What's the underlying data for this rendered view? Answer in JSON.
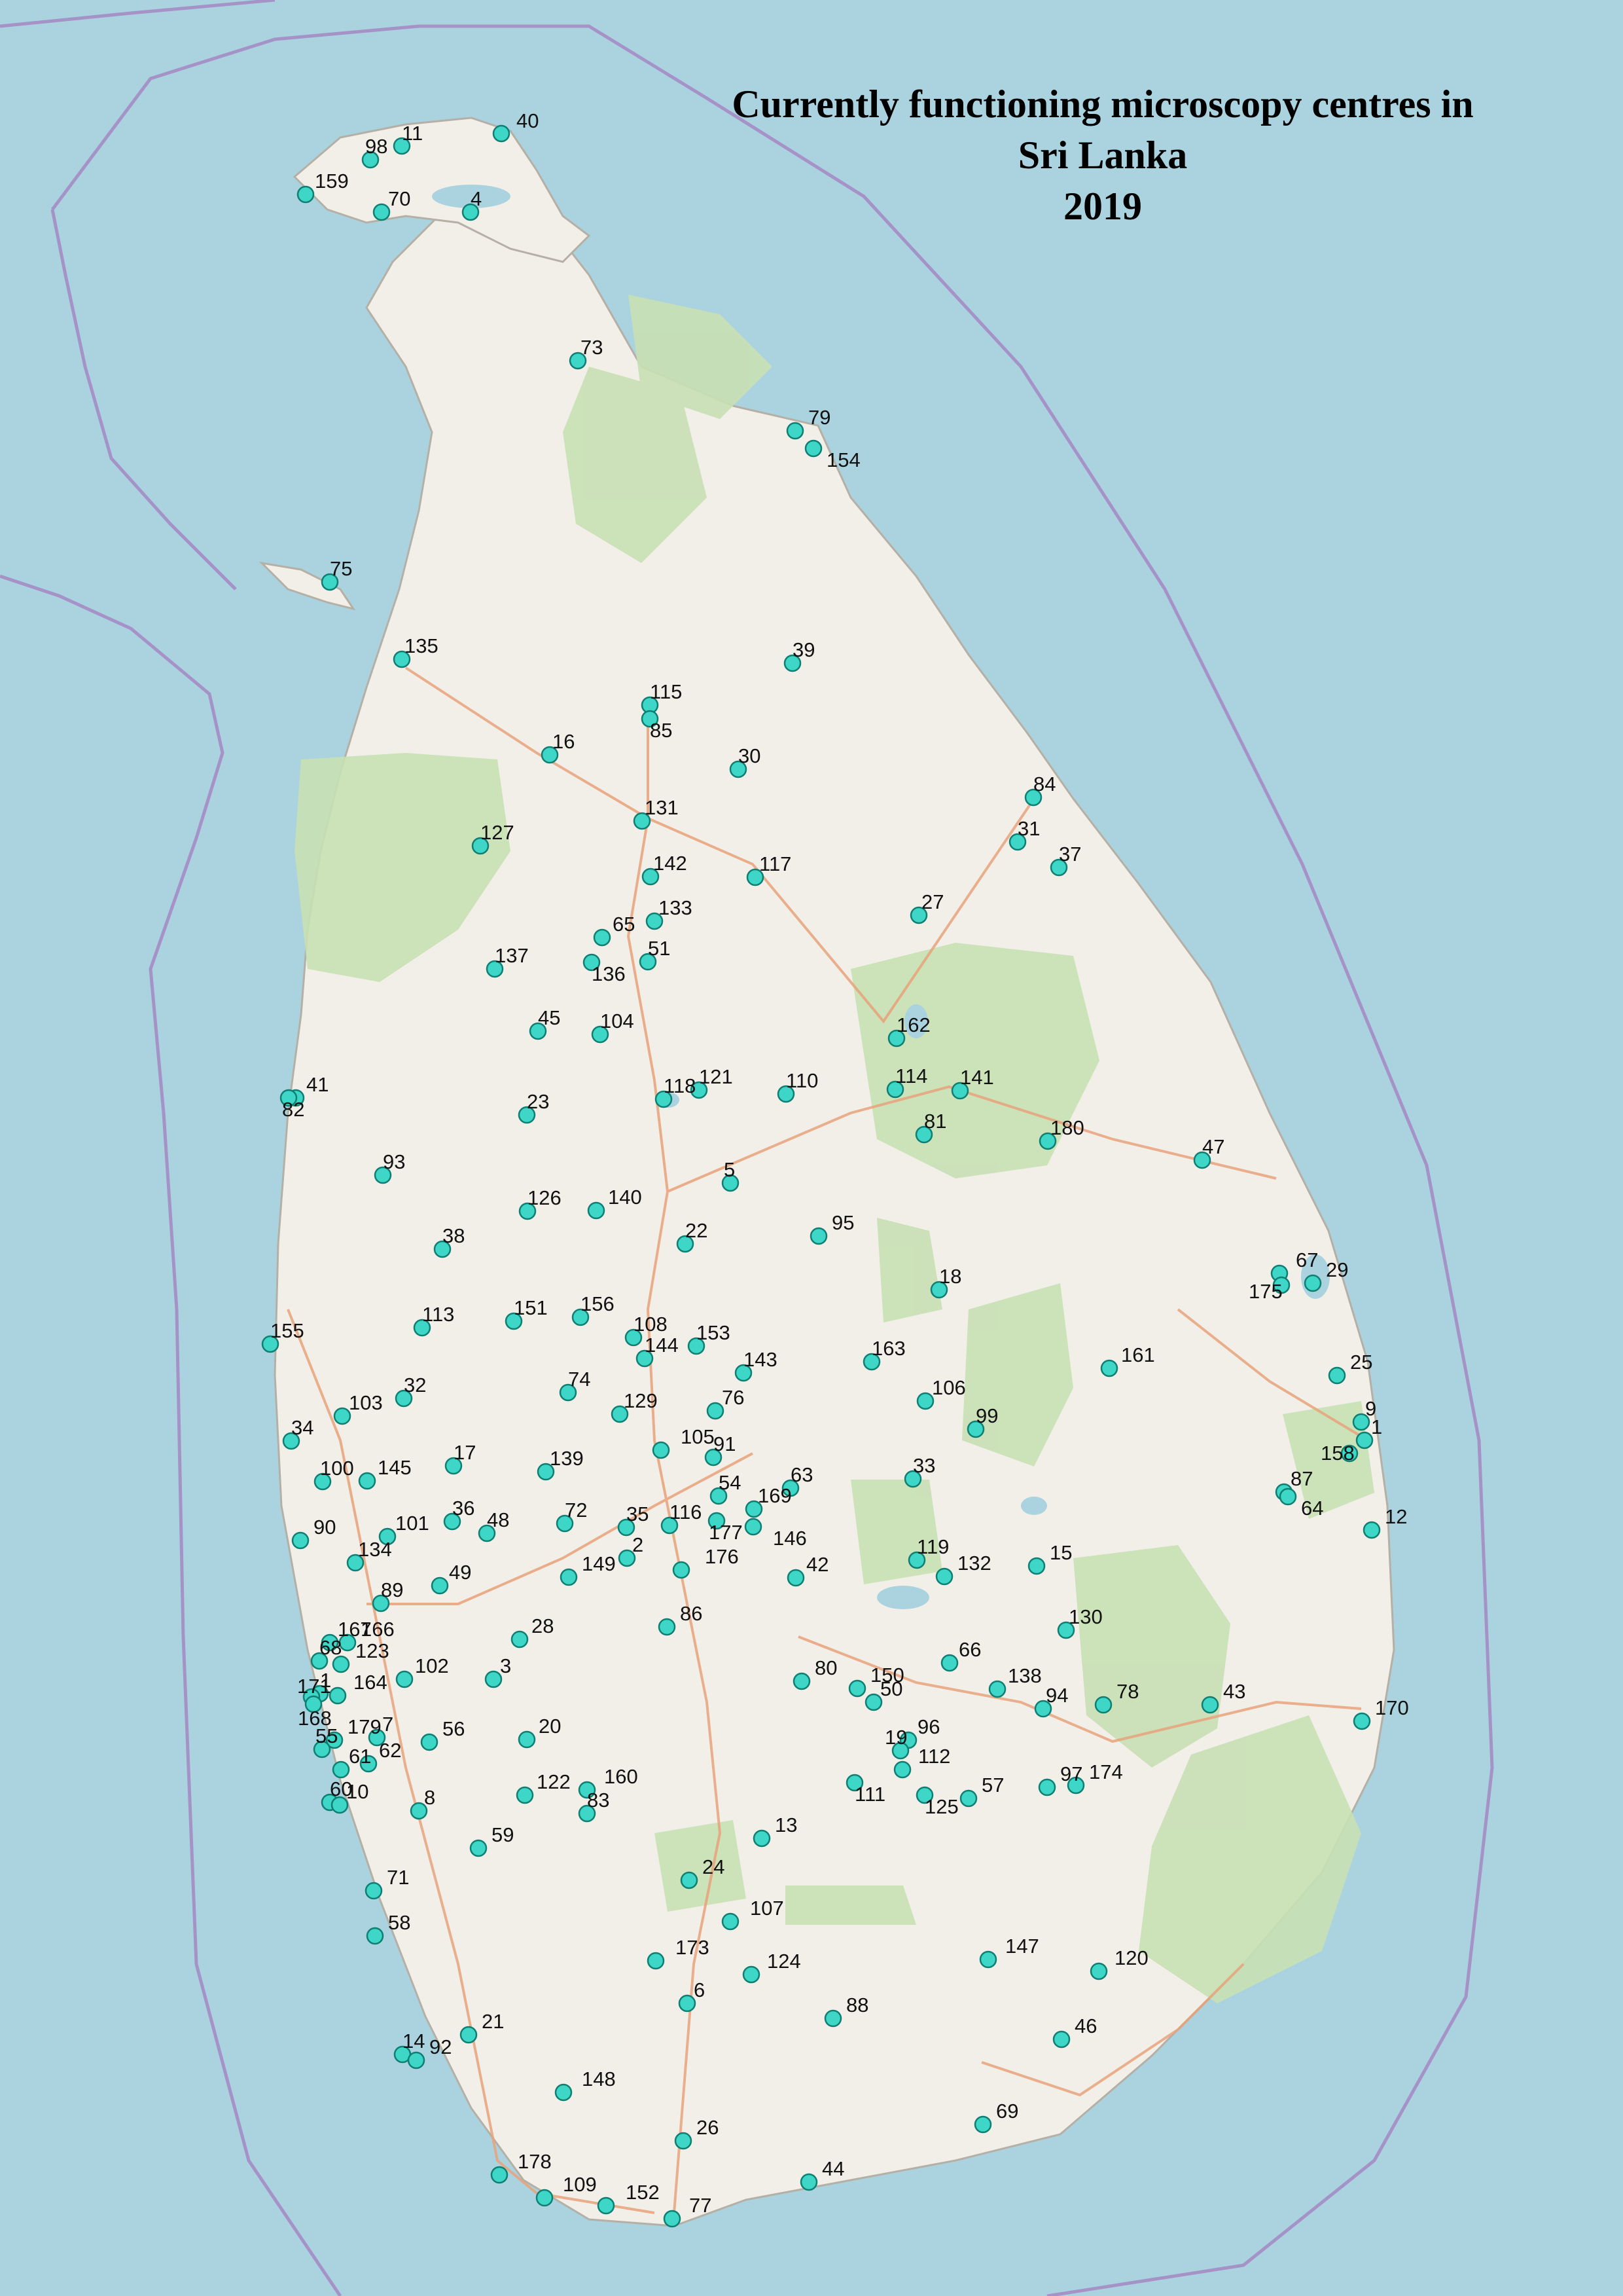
{
  "map": {
    "title": "Currently functioning microscopy centres in",
    "subtitle": "Sri Lanka",
    "year": "2019",
    "colors": {
      "sea": "#aad3df",
      "land": "#f2efe9",
      "park": "#c8e0b4",
      "boundary": "#a593c8",
      "marker_fill": "#3ed6c6",
      "marker_stroke": "#0f7f73"
    },
    "centres": [
      "40",
      "11",
      "98",
      "159",
      "70",
      "4",
      "73",
      "79",
      "154",
      "75",
      "135",
      "39",
      "115",
      "85",
      "16",
      "30",
      "84",
      "131",
      "31",
      "127",
      "37",
      "142",
      "117",
      "27",
      "133",
      "65",
      "51",
      "136",
      "137",
      "45",
      "104",
      "162",
      "41",
      "82",
      "23",
      "118",
      "121",
      "110",
      "114",
      "141",
      "81",
      "180",
      "47",
      "93",
      "5",
      "126",
      "140",
      "95",
      "22",
      "38",
      "67",
      "29",
      "175",
      "18",
      "113",
      "151",
      "156",
      "155",
      "108",
      "144",
      "153",
      "143",
      "163",
      "161",
      "25",
      "106",
      "32",
      "103",
      "74",
      "129",
      "76",
      "99",
      "9",
      "34",
      "17",
      "145",
      "105",
      "91",
      "33",
      "158",
      "1",
      "87",
      "64",
      "139",
      "63",
      "100",
      "54",
      "169",
      "36",
      "72",
      "35",
      "116",
      "177",
      "101",
      "48",
      "12",
      "146",
      "90",
      "2",
      "119",
      "15",
      "176",
      "134",
      "42",
      "132",
      "149",
      "49",
      "89",
      "86",
      "28",
      "130",
      "167",
      "166",
      "68",
      "123",
      "66",
      "3",
      "102",
      "80",
      "150",
      "138",
      "1",
      "171",
      "164",
      "168",
      "50",
      "78",
      "94",
      "43",
      "170",
      "7",
      "56",
      "179",
      "20",
      "55",
      "96",
      "19",
      "112",
      "62",
      "61",
      "60",
      "97",
      "174",
      "122",
      "160",
      "111",
      "125",
      "57",
      "8",
      "10",
      "83",
      "13",
      "59",
      "24",
      "71",
      "107",
      "58",
      "147",
      "173",
      "124",
      "120",
      "6",
      "88",
      "21",
      "46",
      "14",
      "92",
      "148",
      "69",
      "26",
      "178",
      "44",
      "109",
      "152",
      "77"
    ]
  }
}
